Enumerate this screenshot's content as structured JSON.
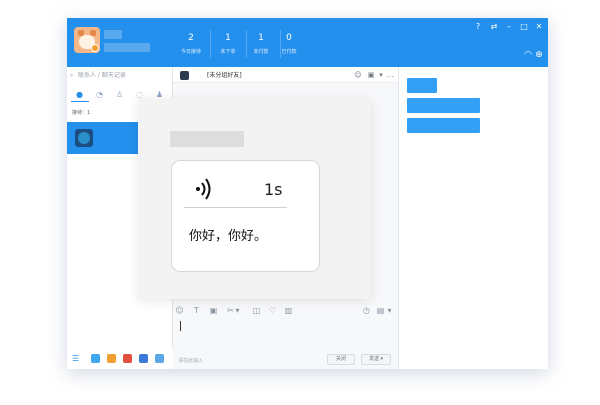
{
  "header": {
    "stats": [
      {
        "value": "2",
        "label": "今日接待"
      },
      {
        "value": "1",
        "label": "未下单"
      },
      {
        "value": "1",
        "label": "未付款"
      },
      {
        "value": "0",
        "label": "已付款"
      }
    ],
    "window_controls": [
      "?",
      "⇄",
      "–",
      "□",
      "✕"
    ]
  },
  "left": {
    "search_placeholder": "联系人 / 聊天记录",
    "receive_label": "接待：1"
  },
  "chat": {
    "title": "[未分组好友]",
    "input_hint": "请在此输入",
    "close_label": "关闭",
    "send_label": "发送 ▾"
  },
  "overlay": {
    "duration": "1s",
    "message": "你好，你好。"
  },
  "colors": {
    "accent": "#2390ee",
    "right_blocks": "#33a0f5"
  }
}
